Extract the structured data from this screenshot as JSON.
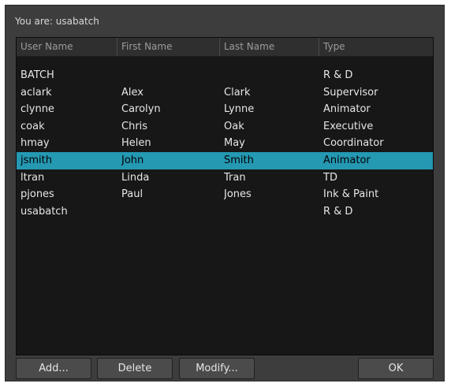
{
  "header_text": "You are: usabatch",
  "table": {
    "columns": [
      "User Name",
      "First Name",
      "Last Name",
      "Type"
    ],
    "rows": [
      [
        "BATCH",
        "",
        "",
        "R & D"
      ],
      [
        "aclark",
        "Alex",
        "Clark",
        "Supervisor"
      ],
      [
        "clynne",
        "Carolyn",
        "Lynne",
        "Animator"
      ],
      [
        "coak",
        "Chris",
        "Oak",
        "Executive"
      ],
      [
        "hmay",
        "Helen",
        "May",
        "Coordinator"
      ],
      [
        "jsmith",
        "John",
        "Smith",
        "Animator"
      ],
      [
        "ltran",
        "Linda",
        "Tran",
        "TD"
      ],
      [
        "pjones",
        "Paul",
        "Jones",
        "Ink & Paint"
      ],
      [
        "usabatch",
        "",
        "",
        "R & D"
      ]
    ],
    "selected_user": "jsmith"
  },
  "buttons": {
    "add": "Add...",
    "delete": "Delete",
    "modify": "Modify...",
    "ok": "OK"
  },
  "colors": {
    "dialog_bg": "#3d3d3d",
    "table_bg": "#171717",
    "selection": "#2598b2"
  }
}
